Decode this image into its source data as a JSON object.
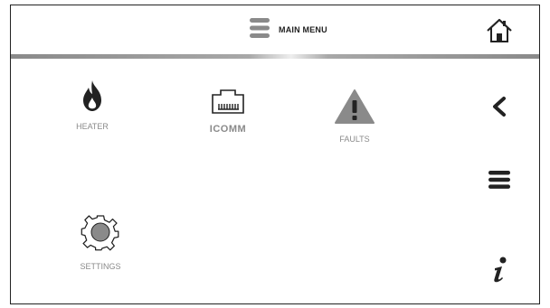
{
  "header": {
    "title": "MAIN MENU",
    "menu_icon": "hamburger-icon",
    "home_icon": "home-icon"
  },
  "tiles": [
    {
      "id": "heater",
      "label": "HEATER",
      "icon": "flame-icon"
    },
    {
      "id": "icomm",
      "label": "ICOMM",
      "icon": "ethernet-port-icon"
    },
    {
      "id": "faults",
      "label": "FAULTS",
      "icon": "warning-triangle-icon"
    },
    {
      "id": "settings",
      "label": "SETTINGS",
      "icon": "gear-icon"
    }
  ],
  "sidebar": {
    "back_icon": "chevron-left-icon",
    "list_icon": "list-icon",
    "info_icon": "info-icon"
  },
  "colors": {
    "icon_dark": "#222222",
    "icon_grey": "#8a8a8a",
    "label_grey": "#8a8a8a",
    "divider": "#a8a8a8"
  }
}
